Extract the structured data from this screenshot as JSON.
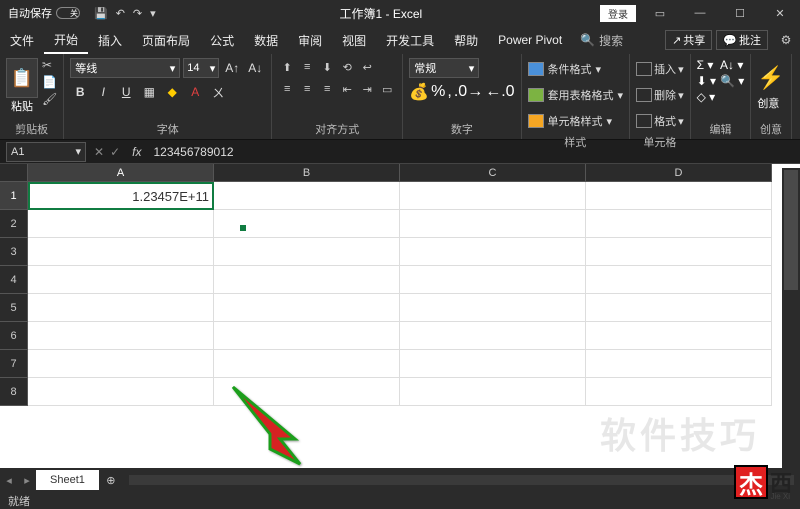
{
  "titlebar": {
    "autosave_label": "自动保存",
    "autosave_state": "关",
    "document": "工作簿1 - Excel",
    "login": "登录"
  },
  "menubar": {
    "tabs": [
      "文件",
      "开始",
      "插入",
      "页面布局",
      "公式",
      "数据",
      "审阅",
      "视图",
      "开发工具",
      "帮助",
      "Power Pivot"
    ],
    "search": "搜索",
    "share": "共享",
    "comments": "批注"
  },
  "ribbon": {
    "clipboard": {
      "paste": "粘贴",
      "group": "剪贴板"
    },
    "font": {
      "name": "等线",
      "size": "14",
      "group": "字体",
      "bold": "B",
      "italic": "I",
      "underline": "U"
    },
    "align": {
      "group": "对齐方式"
    },
    "number": {
      "format": "常规",
      "group": "数字"
    },
    "styles": {
      "cond": "条件格式",
      "table": "套用表格格式",
      "cell": "单元格样式",
      "group": "样式"
    },
    "cells": {
      "insert": "插入",
      "delete": "删除",
      "format": "格式",
      "group": "单元格"
    },
    "editing": {
      "group": "编辑"
    },
    "idea": {
      "label": "创意",
      "group": "创意"
    }
  },
  "formula": {
    "namebox": "A1",
    "value": "123456789012"
  },
  "grid": {
    "cols": [
      "A",
      "B",
      "C",
      "D"
    ],
    "rows": [
      "1",
      "2",
      "3",
      "4",
      "5",
      "6",
      "7",
      "8"
    ],
    "active_cell_value": "1.23457E+11"
  },
  "sheets": {
    "tab": "Sheet1"
  },
  "status": {
    "ready": "就绪"
  },
  "watermark": "软件技巧",
  "logo": {
    "char": "杰",
    "side": "西",
    "sub": "Jie Xi"
  }
}
